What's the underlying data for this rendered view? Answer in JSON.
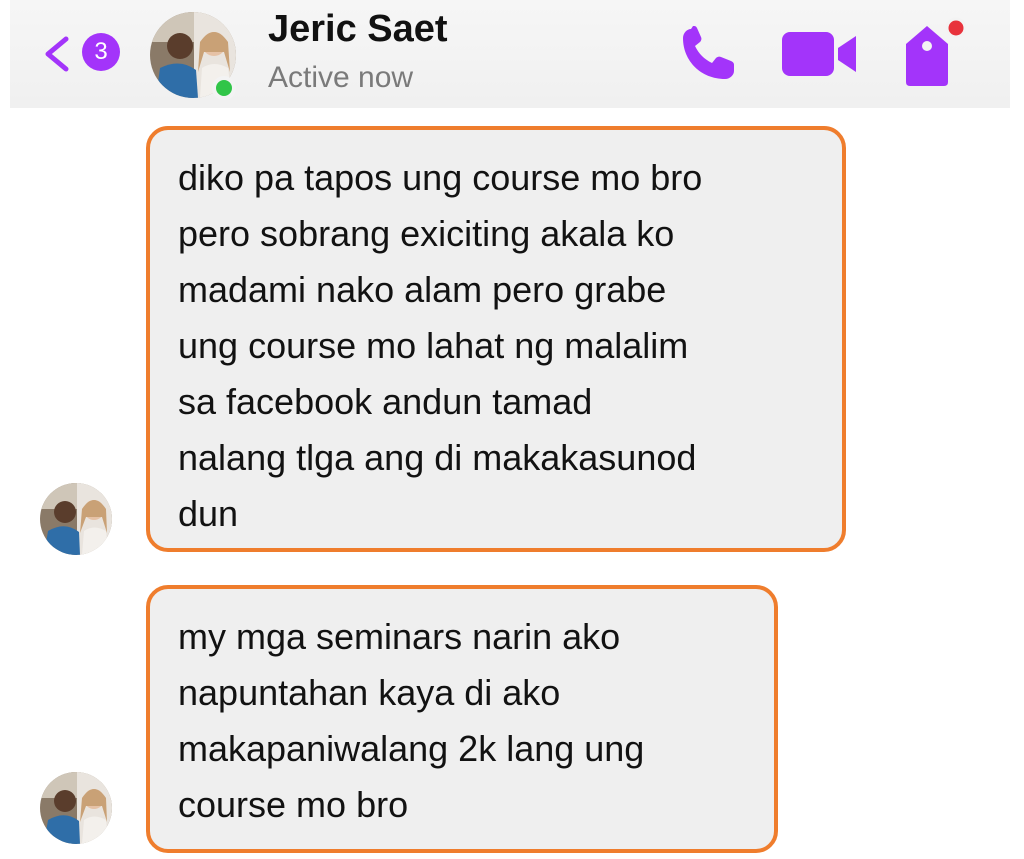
{
  "header": {
    "back_icon": "chevron-left-icon",
    "unread_count": "3",
    "contact_name": "Jeric Saet",
    "status": "Active now",
    "actions": [
      {
        "name": "phone-icon",
        "color": "#a334fa"
      },
      {
        "name": "video-camera-icon",
        "color": "#a334fa"
      },
      {
        "name": "tag-icon",
        "color": "#a334fa",
        "notification_dot_color": "#e8323c"
      }
    ],
    "online_indicator_color": "#31c548"
  },
  "messages": [
    {
      "sender": "Jeric Saet",
      "text": "diko pa tapos ung course mo bro\npero sobrang exiciting akala ko\nmadami nako alam pero grabe\nung course mo lahat ng malalim\nsa facebook andun tamad\nnalang tlga ang di makakasunod\ndun"
    },
    {
      "sender": "Jeric Saet",
      "text": "my mga seminars narin ako\nnapuntahan kaya di ako\nmakapaniwalang 2k lang ung\ncourse mo bro"
    }
  ],
  "colors": {
    "accent": "#a334fa",
    "highlight_border": "#ef7d2d",
    "bubble_background": "#efefef"
  }
}
